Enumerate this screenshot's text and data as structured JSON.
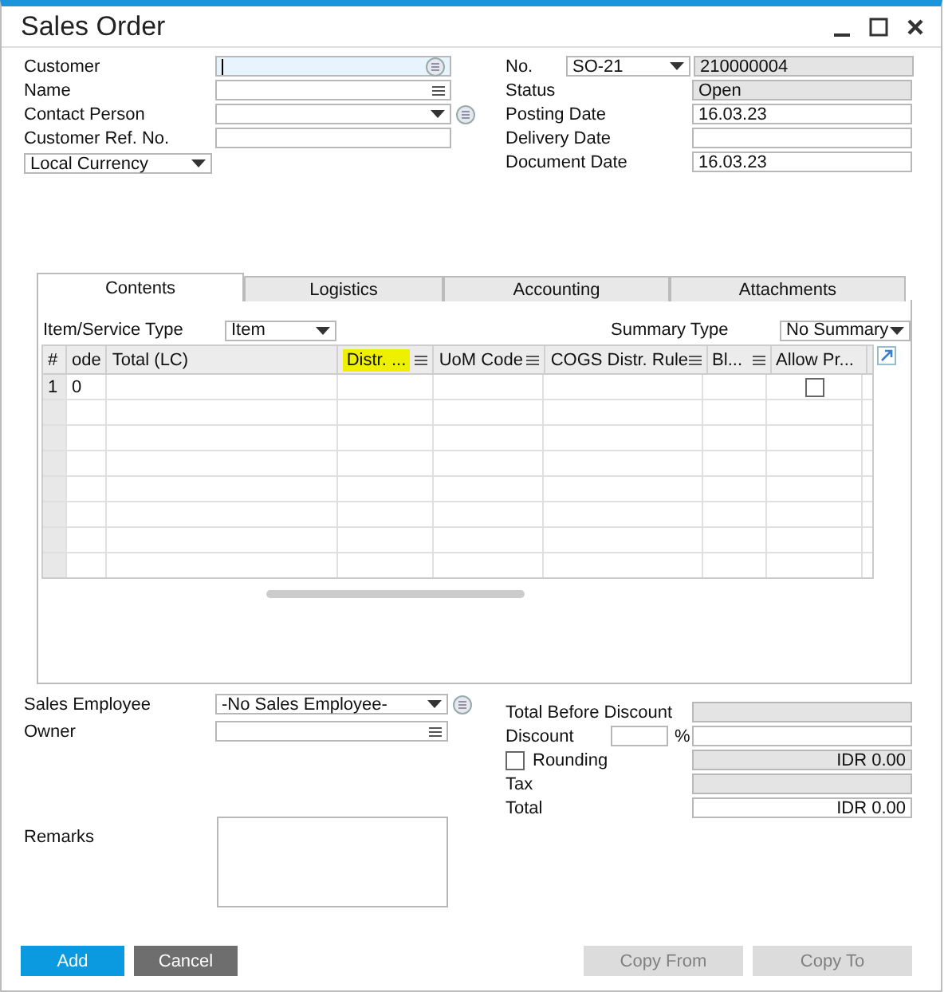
{
  "window": {
    "title": "Sales Order"
  },
  "header_left": [
    {
      "label": "Customer",
      "kind": "lookup",
      "focused": true
    },
    {
      "label": "Name",
      "kind": "list",
      "focused": false
    },
    {
      "label": "Contact Person",
      "kind": "dropdown-link",
      "focused": false
    },
    {
      "label": "Customer Ref. No.",
      "kind": "text",
      "focused": false
    }
  ],
  "currency_select": {
    "value": "Local Currency"
  },
  "number": {
    "label": "No.",
    "series": "SO-21",
    "value": "210000004"
  },
  "header_right": [
    {
      "label": "Status",
      "value": "Open",
      "readonly": true
    },
    {
      "label": "Posting Date",
      "value": "16.03.23",
      "readonly": false
    },
    {
      "label": "Delivery Date",
      "readonly": false
    },
    {
      "label": "Document Date",
      "value": "16.03.23",
      "readonly": false
    }
  ],
  "tabs": [
    {
      "label": "Contents",
      "selected": true
    },
    {
      "label": "Logistics",
      "selected": false
    },
    {
      "label": "Accounting",
      "selected": false
    },
    {
      "label": "Attachments",
      "selected": false
    }
  ],
  "item_type": {
    "label": "Item/Service Type",
    "value": "Item"
  },
  "summary_type": {
    "label": "Summary Type",
    "value": "No Summary"
  },
  "table": {
    "columns": [
      {
        "label": "#",
        "menu": false,
        "highlighted": false
      },
      {
        "label": "ode",
        "menu": false,
        "highlighted": false
      },
      {
        "label": "Total (LC)",
        "menu": false,
        "highlighted": false
      },
      {
        "label": "Distr. ...",
        "menu": true,
        "highlighted": true
      },
      {
        "label": "UoM Code",
        "menu": true,
        "highlighted": false
      },
      {
        "label": "COGS Distr. Rule",
        "menu": true,
        "highlighted": false
      },
      {
        "label": "Bl...",
        "menu": true,
        "highlighted": false
      },
      {
        "label": "Allow Pr...",
        "menu": false,
        "highlighted": false
      }
    ],
    "rows": [
      {
        "number": "1",
        "code": "0",
        "allow_checked": false
      }
    ]
  },
  "sales_employee": {
    "label": "Sales Employee",
    "value": "-No Sales Employee-"
  },
  "owner": {
    "label": "Owner"
  },
  "remarks": {
    "label": "Remarks"
  },
  "totals": [
    {
      "label": "Total Before Discount",
      "kind": "field",
      "readonly": true
    },
    {
      "label": "Discount",
      "kind": "percent",
      "readonly": false,
      "unit": "%"
    },
    {
      "label": "Rounding",
      "kind": "checkbox",
      "checked": false,
      "readonly": true,
      "value": "IDR 0.00"
    },
    {
      "label": "Tax",
      "kind": "field",
      "readonly": true
    },
    {
      "label": "Total",
      "kind": "field",
      "readonly": false,
      "value": "IDR 0.00"
    }
  ],
  "buttons": [
    {
      "label": "Add",
      "kind": "primary",
      "disabled": false
    },
    {
      "label": "Cancel",
      "kind": "secondary",
      "disabled": false
    },
    {
      "label": "Copy From",
      "kind": "secondary",
      "disabled": true
    },
    {
      "label": "Copy To",
      "kind": "secondary",
      "disabled": true
    }
  ]
}
